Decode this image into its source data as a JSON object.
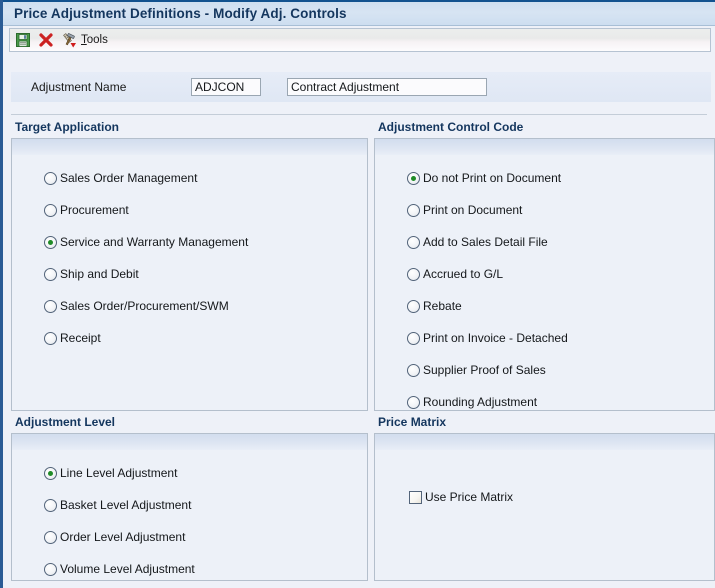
{
  "window": {
    "title": "Price Adjustment Definitions - Modify Adj. Controls"
  },
  "toolbar": {
    "save": {
      "name": "save-icon",
      "tooltip": "Save"
    },
    "cancel": {
      "name": "cancel-icon",
      "tooltip": "Cancel"
    },
    "tools": {
      "name": "tools-icon",
      "label": "Tools",
      "accel": "T"
    }
  },
  "form": {
    "adjustment_name_label": "Adjustment Name",
    "adjustment_code_value": "ADJCON",
    "adjustment_code_placeholder": "",
    "adjustment_desc_value": "Contract Adjustment",
    "adjustment_desc_placeholder": ""
  },
  "panels": {
    "target_application": {
      "title": "Target Application",
      "options": [
        {
          "label": "Sales Order Management",
          "selected": false
        },
        {
          "label": "Procurement",
          "selected": false
        },
        {
          "label": "Service and Warranty Management",
          "selected": true
        },
        {
          "label": "Ship and Debit",
          "selected": false
        },
        {
          "label": "Sales Order/Procurement/SWM",
          "selected": false
        },
        {
          "label": "Receipt",
          "selected": false
        }
      ]
    },
    "adjustment_control_code": {
      "title": "Adjustment Control Code",
      "options": [
        {
          "label": "Do not Print on Document",
          "selected": true
        },
        {
          "label": "Print on Document",
          "selected": false
        },
        {
          "label": "Add to Sales Detail File",
          "selected": false
        },
        {
          "label": "Accrued to G/L",
          "selected": false
        },
        {
          "label": "Rebate",
          "selected": false
        },
        {
          "label": "Print on Invoice - Detached",
          "selected": false
        },
        {
          "label": "Supplier Proof of Sales",
          "selected": false
        },
        {
          "label": "Rounding Adjustment",
          "selected": false
        }
      ]
    },
    "adjustment_level": {
      "title": "Adjustment Level",
      "options": [
        {
          "label": "Line Level Adjustment",
          "selected": true
        },
        {
          "label": "Basket Level Adjustment",
          "selected": false
        },
        {
          "label": "Order Level Adjustment",
          "selected": false
        },
        {
          "label": "Volume Level Adjustment",
          "selected": false
        }
      ]
    },
    "price_matrix": {
      "title": "Price Matrix",
      "checkboxes": [
        {
          "label": "Use Price Matrix",
          "checked": false
        }
      ]
    }
  },
  "colors": {
    "title_text": "#14365e",
    "window_border": "#2a5b95",
    "panel_bg": "#edf1f8",
    "radio_selected_dot": "#1f8b27",
    "save_icon_green": "#3f9a3f",
    "cancel_icon_red": "#cc2222"
  }
}
